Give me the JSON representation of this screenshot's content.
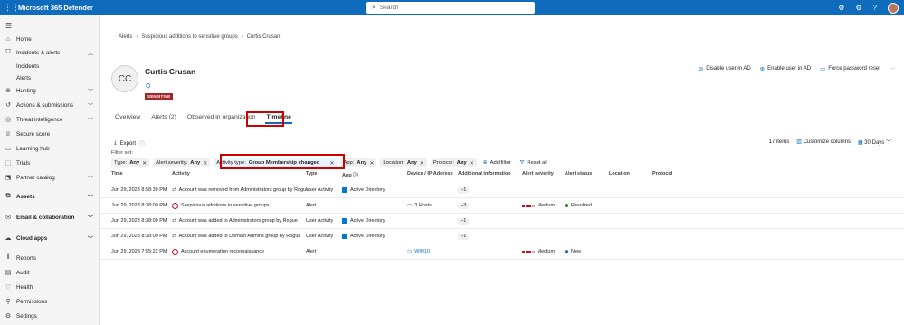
{
  "app": {
    "title": "Microsoft 365 Defender",
    "search_placeholder": "Search"
  },
  "sidebar": {
    "items": [
      {
        "label": "Home",
        "icon": "home-icon"
      },
      {
        "label": "Incidents & alerts",
        "icon": "shield-icon",
        "expanded": true
      },
      {
        "label": "Incidents",
        "sub": true
      },
      {
        "label": "Alerts",
        "sub": true
      },
      {
        "label": "Hunting",
        "icon": "hunting-icon"
      },
      {
        "label": "Actions & submissions",
        "icon": "actions-icon"
      },
      {
        "label": "Threat intelligence",
        "icon": "threat-icon"
      },
      {
        "label": "Secure score",
        "icon": "trophy-icon"
      },
      {
        "label": "Learning hub",
        "icon": "learning-icon"
      },
      {
        "label": "Trials",
        "icon": "trials-icon"
      },
      {
        "label": "Partner catalog",
        "icon": "catalog-icon"
      },
      {
        "label": "Assets",
        "icon": "assets-icon"
      },
      {
        "label": "Email & collaboration",
        "icon": "email-icon"
      },
      {
        "label": "Cloud apps",
        "icon": "cloud-icon"
      },
      {
        "label": "Reports",
        "icon": "reports-icon"
      },
      {
        "label": "Audit",
        "icon": "audit-icon"
      },
      {
        "label": "Health",
        "icon": "health-icon"
      },
      {
        "label": "Permissions",
        "icon": "permissions-icon"
      },
      {
        "label": "Settings",
        "icon": "settings-icon"
      }
    ]
  },
  "breadcrumb": [
    "Alerts",
    "Suspicious additions to sensitive groups",
    "Curtis Crusan"
  ],
  "user": {
    "initials": "CC",
    "name": "Curtis Crusan",
    "tag": "SENSITIVE"
  },
  "actions": {
    "disable": "Disable user in AD",
    "enable": "Enable user in AD",
    "reset": "Force password reset",
    "more": "···"
  },
  "tabs": [
    "Overview",
    "Alerts (2)",
    "Observed in organization",
    "Timeline"
  ],
  "toolbar": {
    "export": "Export",
    "items_count": "17 items",
    "customize": "Customize columns",
    "range": "30 Days"
  },
  "filters": {
    "label": "Filter set:",
    "chips": [
      {
        "key": "Type:",
        "value": "Any"
      },
      {
        "key": "Alert severity:",
        "value": "Any"
      },
      {
        "key": "Activity type:",
        "value": "Group Membership changed"
      },
      {
        "key": "App:",
        "value": "Any"
      },
      {
        "key": "Location:",
        "value": "Any"
      },
      {
        "key": "Protocol:",
        "value": "Any"
      }
    ],
    "add": "Add filter",
    "reset": "Reset all"
  },
  "table": {
    "headers": [
      "Time",
      "Activity",
      "Type",
      "App",
      "Device / IP Address",
      "Additional information",
      "Alert severity",
      "Alert status",
      "Location",
      "Protocol"
    ],
    "rows": [
      {
        "time": "Jun 29, 2023 8:58:39 PM",
        "activity": "Account was removed from Administrators group by Rogue",
        "type": "User Activity",
        "app": "Active Directory",
        "device": "",
        "info": "+1",
        "severity": "",
        "status": ""
      },
      {
        "time": "Jun 29, 2023 8:38:00 PM",
        "activity": "Suspicious additions to sensitive groups",
        "type": "Alert",
        "app": "",
        "device": "3 Hosts",
        "info": "+3",
        "severity": "Medium",
        "status": "Resolved"
      },
      {
        "time": "Jun 29, 2023 8:38:00 PM",
        "activity": "Account was added to Administrators group by Rogue",
        "type": "User Activity",
        "app": "Active Directory",
        "device": "",
        "info": "+1",
        "severity": "",
        "status": ""
      },
      {
        "time": "Jun 29, 2023 8:38:00 PM",
        "activity": "Account was added to Domain Admins group by Rogue",
        "type": "User Activity",
        "app": "Active Directory",
        "device": "",
        "info": "+1",
        "severity": "",
        "status": ""
      },
      {
        "time": "Jun 29, 2023 7:55:22 PM",
        "activity": "Account enumeration reconnaissance",
        "type": "Alert",
        "app": "",
        "device": "WIN10",
        "info": "",
        "severity": "Medium",
        "status": "New"
      }
    ]
  },
  "colors": {
    "brand": "#0f6cbd",
    "highlight": "#d00000",
    "resolved": "#107c10",
    "new": "#0f6cbd",
    "severity": "#c50f1f"
  }
}
